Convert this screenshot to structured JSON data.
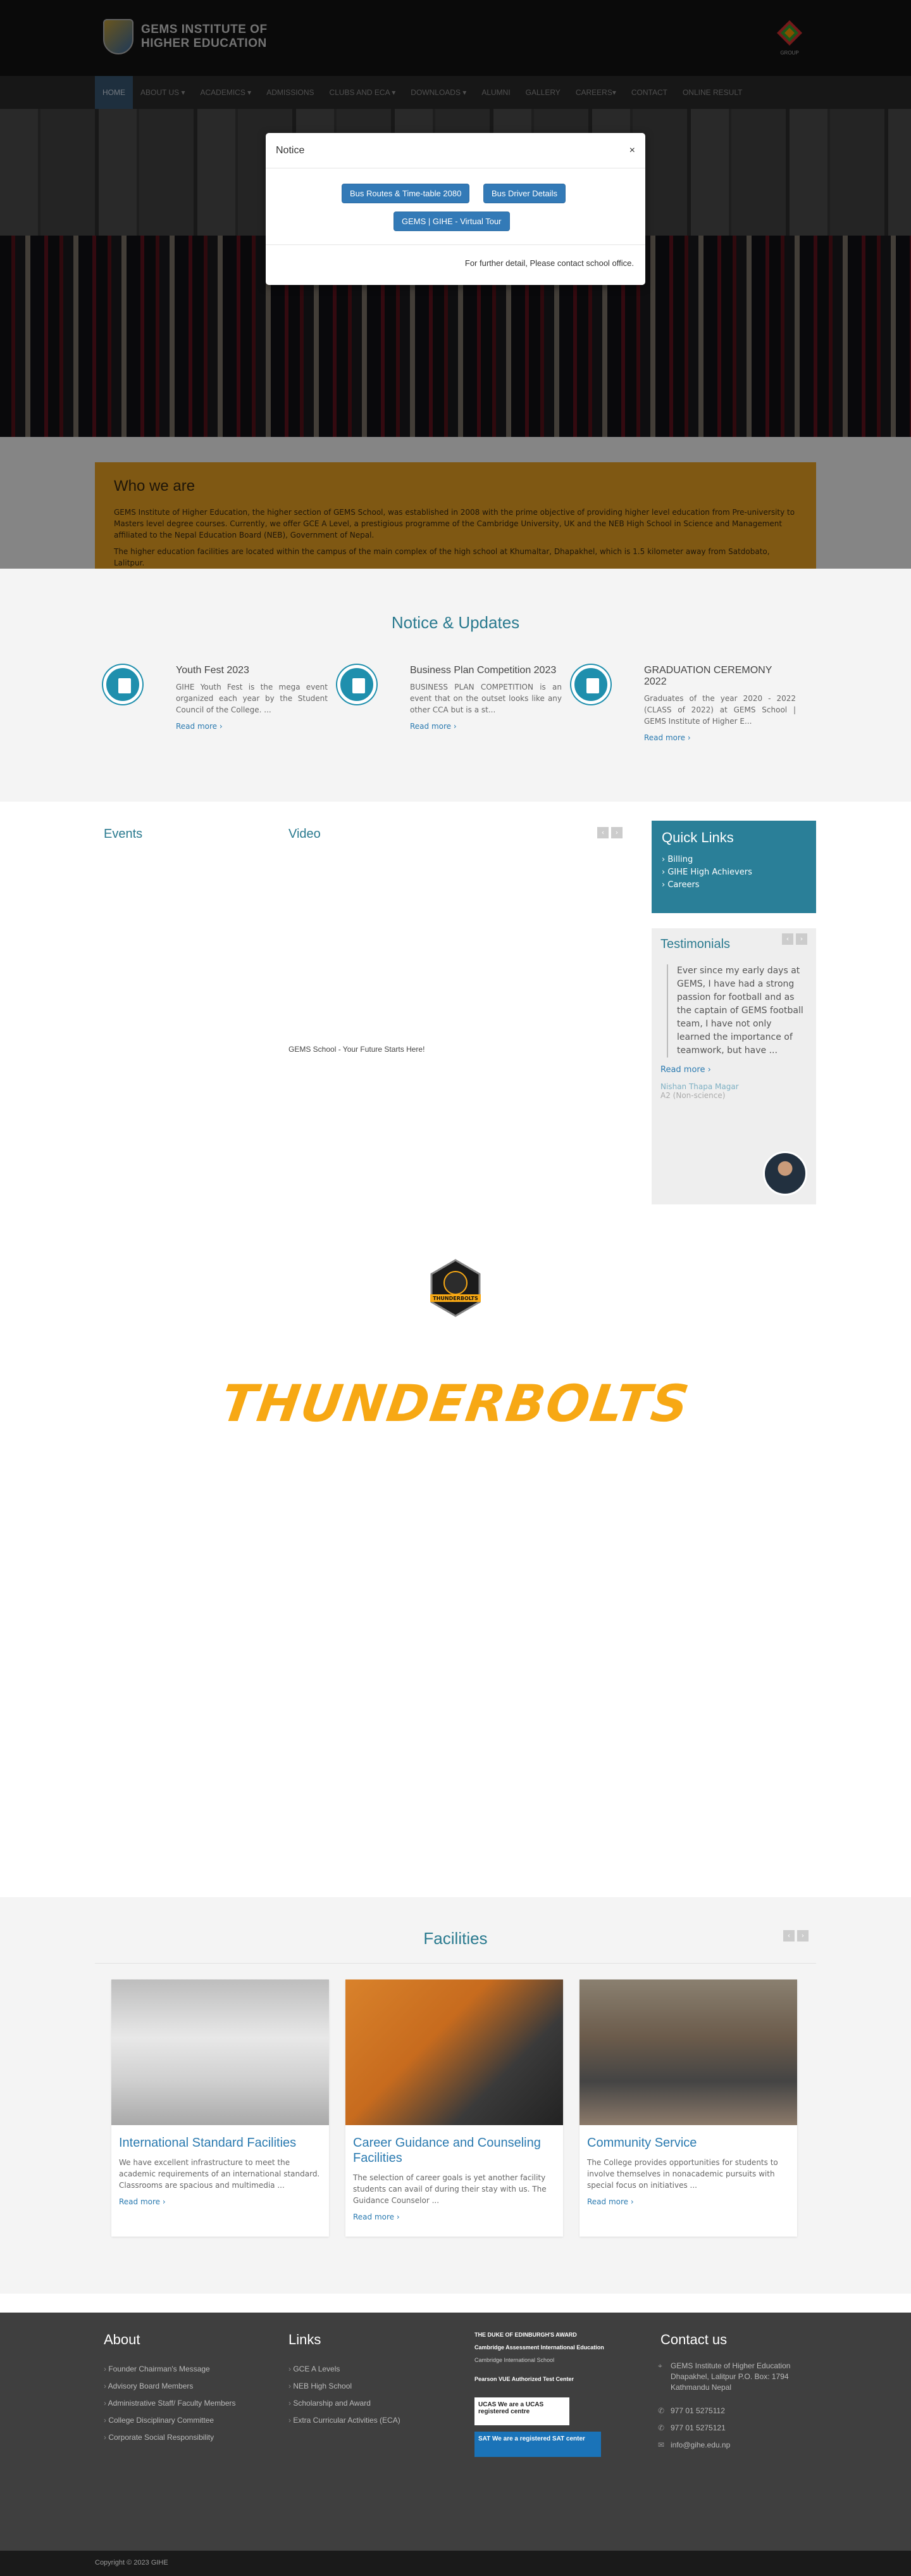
{
  "header": {
    "title_line1": "GEMS INSTITUTE OF",
    "title_line2": "HIGHER EDUCATION",
    "group_label": "GROUP"
  },
  "nav": [
    "HOME",
    "ABOUT US ▾",
    "ACADEMICS ▾",
    "ADMISSIONS",
    "CLUBS AND ECA ▾",
    "DOWNLOADS ▾",
    "ALUMNI",
    "GALLERY",
    "CAREERS▾",
    "CONTACT",
    "ONLINE RESULT"
  ],
  "modal": {
    "title": "Notice",
    "close": "×",
    "btn1": "Bus Routes & Time-table 2080",
    "btn2": "Bus Driver Details",
    "btn3": "GEMS | GIHE - Virtual Tour",
    "footer": "For further detail, Please contact school office."
  },
  "who": {
    "title": "Who we are",
    "p1": "GEMS Institute of Higher Education, the higher section of GEMS School, was established in 2008 with the prime objective of providing higher level education from Pre-university to Masters level degree courses. Currently, we offer GCE A Level, a prestigious programme of the Cambridge University, UK and the NEB High School in Science and Management affiliated to the Nepal Education Board (NEB), Government of Nepal.",
    "p2": "The higher education facilities are located within the campus of the main complex of the high school at Khumaltar, Dhapakhel, which is 1.5 kilometer away from Satdobato, Lalitpur."
  },
  "notices": {
    "title": "Notice & Updates",
    "items": [
      {
        "title": "Youth Fest 2023",
        "text": "GIHE Youth Fest is the mega event organized each year by the Student Council of the College. ...",
        "link": "Read more"
      },
      {
        "title": "Business Plan Competition 2023",
        "text": "BUSINESS PLAN COMPETITION is an event that on the outset looks like any other CCA but is a st...",
        "link": "Read more"
      },
      {
        "title": "GRADUATION CEREMONY 2022",
        "text": "Graduates of the year 2020 - 2022 (CLASS of 2022) at GEMS School | GEMS Institute of Higher E...",
        "link": "Read more"
      }
    ]
  },
  "events": {
    "title": "Events",
    "video_title": "Video",
    "video_caption": "GEMS School - Your Future Starts Here!",
    "prev": "‹",
    "next": "›"
  },
  "quicklinks": {
    "title": "Quick Links",
    "items": [
      "Billing",
      "GIHE High Achievers",
      "Careers"
    ]
  },
  "testimonials": {
    "title": "Testimonials",
    "quote": "Ever since my early days at GEMS, I have had a strong passion for football and as the captain of GEMS football team, I have not only learned the importance of teamwork, but have ...",
    "link": "Read more",
    "name": "Nishan Thapa Magar",
    "class": "A2 (Non-science)"
  },
  "thunderbolts": {
    "logo_text": "THUNDERBOLTS",
    "banner": "THUNDERBOLTS"
  },
  "facilities": {
    "title": "Facilities",
    "items": [
      {
        "title": "International Standard Facilities",
        "text": "We have excellent infrastructure to meet the academic requirements of an international standard. Classrooms are spacious and multimedia ...",
        "link": "Read more"
      },
      {
        "title": "Career Guidance and Counseling Facilities",
        "text": "The selection of career goals is yet another facility students can avail of during their stay with us. The Guidance Counselor ...",
        "link": "Read more"
      },
      {
        "title": "Community Service",
        "text": "The College provides opportunities for students to involve themselves in nonacademic pursuits with special focus on initiatives ...",
        "link": "Read more"
      }
    ]
  },
  "footer": {
    "about_title": "About",
    "about": [
      "Founder Chairman's Message",
      "Advisory Board Members",
      "Administrative Staff/ Faculty Members",
      "College Disciplinary Committee",
      "Corporate Social Responsibility"
    ],
    "links_title": "Links",
    "links": [
      "GCE A Levels",
      "NEB High School",
      "Scholarship and Award",
      "Extra Curricular Activities (ECA)"
    ],
    "logos": [
      "THE DUKE OF EDINBURGH'S AWARD",
      "Cambridge Assessment International Education",
      "Cambridge International School",
      "Pearson VUE Authorized Test Center",
      "UCAS We are a UCAS registered centre",
      "SAT We are a registered SAT center"
    ],
    "contact_title": "Contact us",
    "address": "GEMS Institute of Higher Education Dhapakhel, Lalitpur P.O. Box: 1794 Kathmandu Nepal",
    "phone1": "977 01 5275112",
    "phone2": "977 01 5275121",
    "email": "info@gihe.edu.np",
    "copyright": "Copyright © 2023 GIHE"
  }
}
